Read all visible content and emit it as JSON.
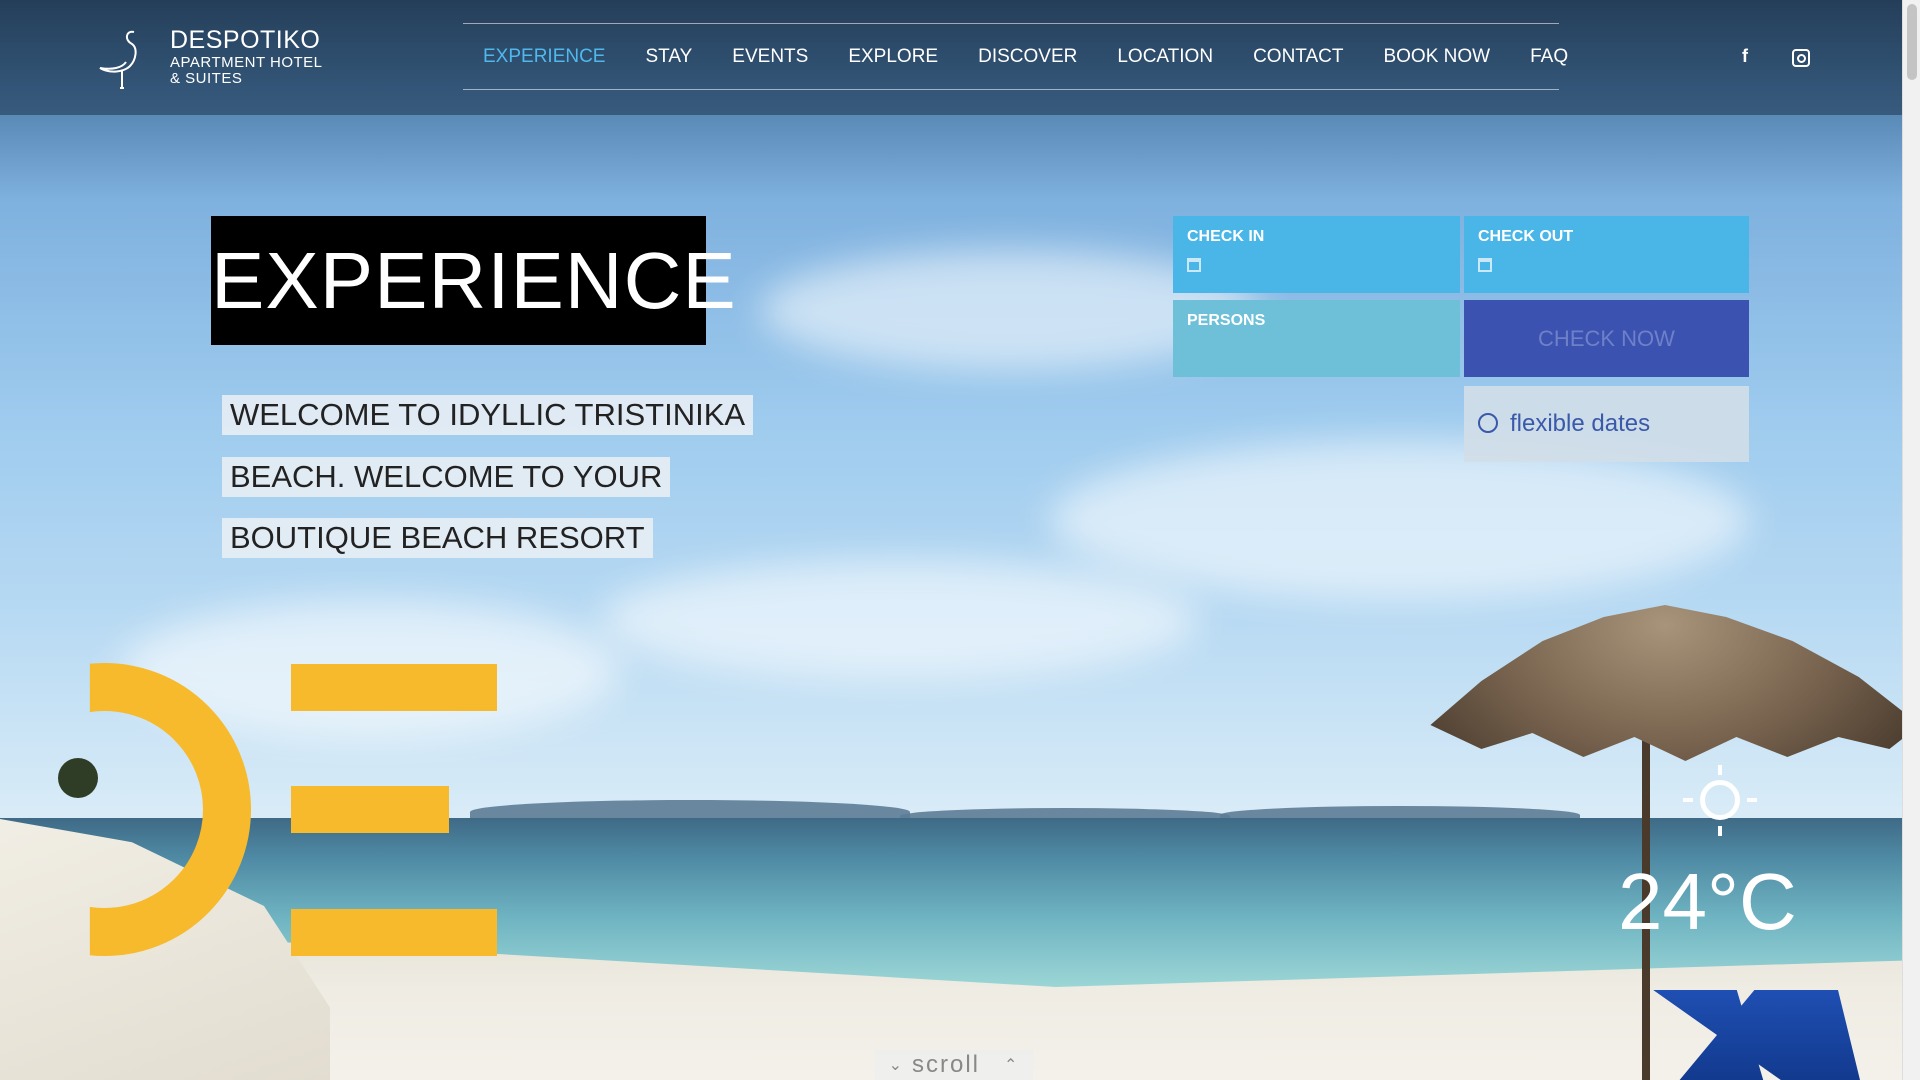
{
  "brand": {
    "name": "DESPOTIKO",
    "subtitle_line1": "APARTMENT HOTEL",
    "subtitle_line2": "& SUITES"
  },
  "nav": {
    "items": [
      {
        "label": "EXPERIENCE",
        "active": true
      },
      {
        "label": "STAY"
      },
      {
        "label": "EVENTS"
      },
      {
        "label": "EXPLORE"
      },
      {
        "label": "DISCOVER"
      },
      {
        "label": "LOCATION"
      },
      {
        "label": "CONTACT"
      },
      {
        "label": "BOOK NOW"
      },
      {
        "label": "FAQ"
      }
    ],
    "active_color": "#4fb8ec"
  },
  "social": {
    "facebook": "f",
    "icons": [
      "facebook-icon",
      "instagram-icon"
    ]
  },
  "hero": {
    "title": "EXPERIENCE",
    "lines": [
      "WELCOME TO IDYLLIC TRISTINIKA",
      "BEACH. WELCOME TO YOUR",
      "BOUTIQUE BEACH RESORT"
    ]
  },
  "booking": {
    "check_in_label": "CHECK IN",
    "check_out_label": "CHECK OUT",
    "persons_label": "PERSONS",
    "check_now_label": "CHECK NOW",
    "flexible_dates_label": "flexible dates",
    "colors": {
      "field": "#4ab6e8",
      "persons": "#6ec0d9",
      "button": "#3c52b0"
    }
  },
  "weather": {
    "temperature": "24°C",
    "icon": "sun-icon"
  },
  "scroll": {
    "label": "scroll"
  },
  "colors": {
    "accent_yellow": "#f6ba2c"
  }
}
